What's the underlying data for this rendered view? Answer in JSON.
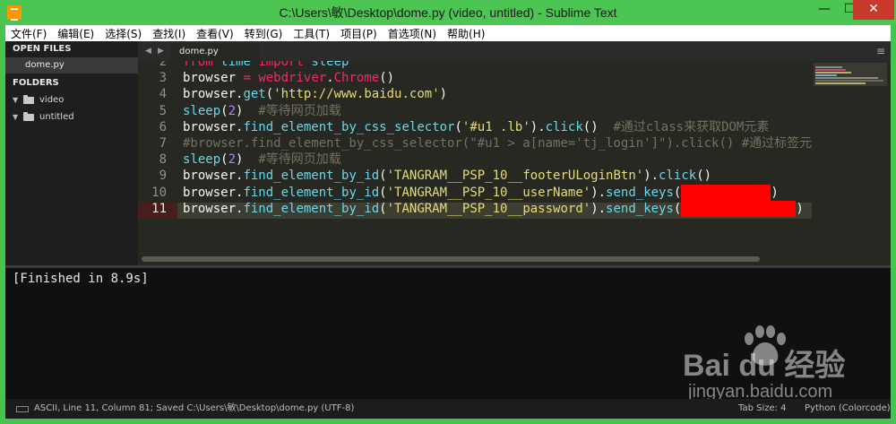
{
  "window": {
    "title": "C:\\Users\\敏\\Desktop\\dome.py (video, untitled) - Sublime Text",
    "controls": {
      "minimize": "—",
      "maximize": "☐",
      "close": "✕"
    }
  },
  "menu": [
    "文件(F)",
    "编辑(E)",
    "选择(S)",
    "查找(I)",
    "查看(V)",
    "转到(G)",
    "工具(T)",
    "项目(P)",
    "首选项(N)",
    "帮助(H)"
  ],
  "sidebar": {
    "open_files_heading": "OPEN FILES",
    "open_files": [
      "dome.py"
    ],
    "folders_heading": "FOLDERS",
    "folders": [
      "video",
      "untitled"
    ]
  },
  "tabs": {
    "active": "dome.py",
    "left_arrow": "◀",
    "right_arrow": "▶",
    "menu": "≡"
  },
  "editor": {
    "line_numbers": [
      "2",
      "3",
      "4",
      "5",
      "6",
      "7",
      "8",
      "9",
      "10",
      "11"
    ],
    "current_line": "11",
    "lines": [
      "from time import sleep",
      "browser = webdriver.Chrome()",
      "browser.get('http://www.baidu.com')",
      "sleep(2)  #等待网页加载",
      "browser.find_element_by_css_selector('#u1 .lb').click()  #通过class来获取DOM元素",
      "#browser.find_element_by_css_selector(\"#u1 > a[name='tj_login']\").click() #通过标签元",
      "sleep(2)  #等待网页加载",
      "browser.find_element_by_id('TANGRAM__PSP_10__footerULoginBtn').click()",
      "browser.find_element_by_id('TANGRAM__PSP_10__userName').send_keys(",
      "browser.find_element_by_id('TANGRAM__PSP_10__password').send_keys("
    ]
  },
  "output": {
    "text": "[Finished in 8.9s]"
  },
  "watermark": {
    "logo": "Bai du 经验",
    "site": "jingyan.baidu.com"
  },
  "statusbar": {
    "left": "ASCII, Line 11, Column 81; Saved C:\\Users\\敏\\Desktop\\dome.py (UTF-8)",
    "tab_size": "Tab Size: 4",
    "syntax": "Python (Colorcode)"
  },
  "colors": {
    "window_frame": "#47c44f",
    "editor_bg": "#272822",
    "keyword": "#f92672",
    "function": "#66d9ef",
    "string": "#e6db74",
    "number": "#ae81ff",
    "comment": "#75715e",
    "redaction": "#ff0000",
    "close_button": "#c73a2c"
  }
}
